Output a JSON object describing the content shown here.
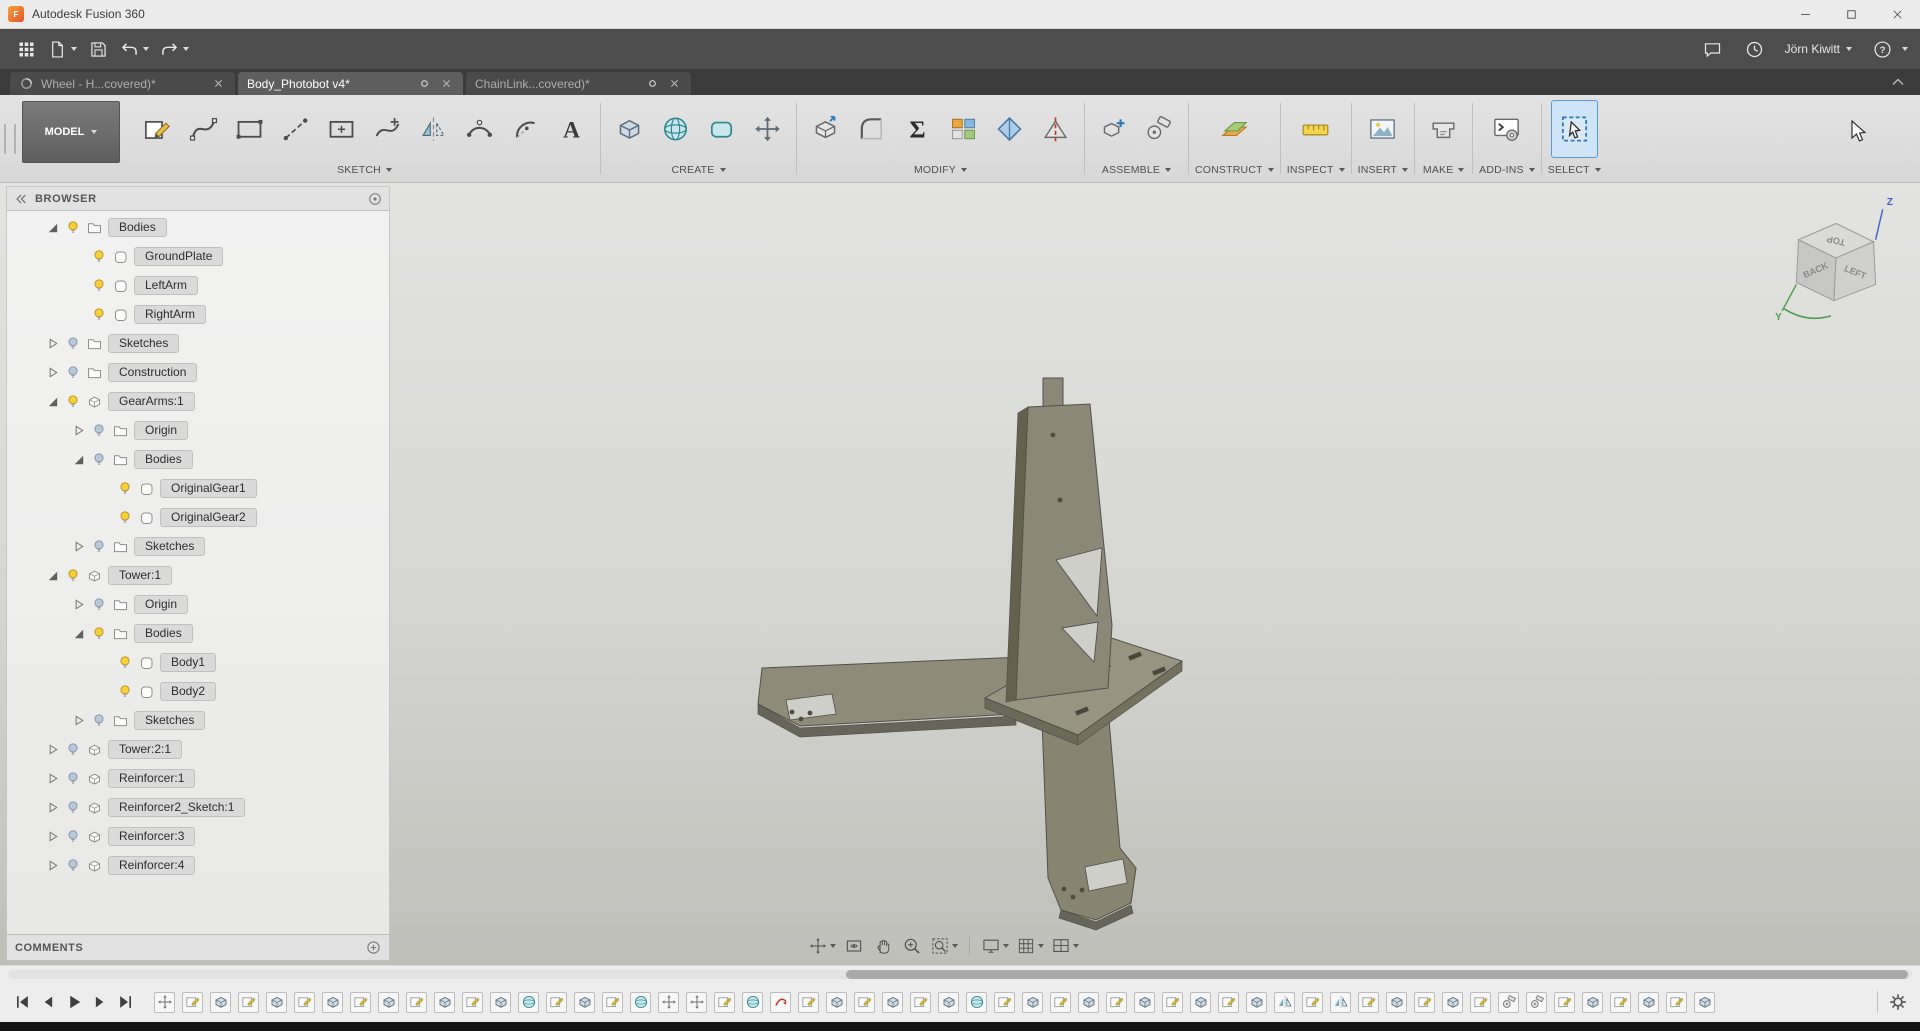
{
  "colors": {
    "accent_blue": "#2e78c2",
    "bulb_on": "#f6cf39",
    "bulb_off": "#b8c8d8",
    "model_olive": "#8b8877",
    "logo_orange": "#e2552b"
  },
  "title_bar": {
    "app_title": "Autodesk Fusion 360",
    "window_controls": [
      "minimize",
      "maximize",
      "close"
    ]
  },
  "quick_access": {
    "left_icons": [
      "apps-grid",
      "file-menu",
      "save",
      "undo",
      "redo"
    ],
    "right_icons": [
      "comment",
      "job-status"
    ],
    "user_name": "Jörn Kiwitt",
    "help_label": "?"
  },
  "document_tabs": {
    "overflow_icon": "chevron-up",
    "tabs": [
      {
        "label": "Wheel - H...covered)*",
        "active": false,
        "leading_icon": "fusion-doc",
        "status_dot": false
      },
      {
        "label": "Body_Photobot v4*",
        "active": true,
        "leading_icon": null,
        "status_dot": true
      },
      {
        "label": "ChainLink...covered)*",
        "active": false,
        "leading_icon": null,
        "status_dot": true
      }
    ]
  },
  "ribbon": {
    "workspace_label": "MODEL",
    "groups": [
      {
        "label": "SKETCH",
        "icons": [
          "create-sketch",
          "spline",
          "rectangle-2-point",
          "construction-line",
          "rectangle-center",
          "spline-point",
          "mirror-sketch",
          "arc-3-point",
          "arc-center",
          "sketch-text"
        ]
      },
      {
        "label": "CREATE",
        "icons": [
          "extrude",
          "sphere",
          "box",
          "form"
        ]
      },
      {
        "label": "MODIFY",
        "icons": [
          "press-pull",
          "fillet",
          "change-parameters",
          "appearance",
          "section-analysis",
          "split-body"
        ]
      },
      {
        "label": "ASSEMBLE",
        "icons": [
          "new-component",
          "joint"
        ]
      },
      {
        "label": "CONSTRUCT",
        "icons": [
          "construction-plane"
        ]
      },
      {
        "label": "INSPECT",
        "icons": [
          "measure"
        ]
      },
      {
        "label": "INSERT",
        "icons": [
          "insert-image"
        ]
      },
      {
        "label": "MAKE",
        "icons": [
          "3d-print"
        ]
      },
      {
        "label": "ADD-INS",
        "icons": [
          "scripts-addins"
        ]
      },
      {
        "label": "SELECT",
        "icons": [
          "select-tool"
        ]
      }
    ]
  },
  "browser": {
    "header_label": "BROWSER",
    "collapse_icon": "collapse-left",
    "menu_icon": "circle-dot",
    "comments_label": "COMMENTS",
    "comments_icon": "circle-plus",
    "tree": [
      {
        "label": "Bodies",
        "level": 0,
        "expand": "open",
        "bulb": "on",
        "icon": "folder"
      },
      {
        "label": "GroundPlate",
        "level": 1,
        "expand": "none",
        "bulb": "on",
        "icon": "body"
      },
      {
        "label": "LeftArm",
        "level": 1,
        "expand": "none",
        "bulb": "on",
        "icon": "body"
      },
      {
        "label": "RightArm",
        "level": 1,
        "expand": "none",
        "bulb": "on",
        "icon": "body"
      },
      {
        "label": "Sketches",
        "level": 0,
        "expand": "closed",
        "bulb": "off",
        "icon": "folder"
      },
      {
        "label": "Construction",
        "level": 0,
        "expand": "closed",
        "bulb": "off",
        "icon": "folder"
      },
      {
        "label": "GearArms:1",
        "level": 0,
        "expand": "open",
        "bulb": "on",
        "icon": "component"
      },
      {
        "label": "Origin",
        "level": 1,
        "expand": "closed",
        "bulb": "off",
        "icon": "folder"
      },
      {
        "label": "Bodies",
        "level": 1,
        "expand": "open",
        "bulb": "off",
        "icon": "folder"
      },
      {
        "label": "OriginalGear1",
        "level": 2,
        "expand": "none",
        "bulb": "on",
        "icon": "body"
      },
      {
        "label": "OriginalGear2",
        "level": 2,
        "expand": "none",
        "bulb": "on",
        "icon": "body"
      },
      {
        "label": "Sketches",
        "level": 1,
        "expand": "closed",
        "bulb": "off",
        "icon": "folder"
      },
      {
        "label": "Tower:1",
        "level": 0,
        "expand": "open",
        "bulb": "on",
        "icon": "component"
      },
      {
        "label": "Origin",
        "level": 1,
        "expand": "closed",
        "bulb": "off",
        "icon": "folder"
      },
      {
        "label": "Bodies",
        "level": 1,
        "expand": "open",
        "bulb": "on",
        "icon": "folder"
      },
      {
        "label": "Body1",
        "level": 2,
        "expand": "none",
        "bulb": "on",
        "icon": "body"
      },
      {
        "label": "Body2",
        "level": 2,
        "expand": "none",
        "bulb": "on",
        "icon": "body"
      },
      {
        "label": "Sketches",
        "level": 1,
        "expand": "closed",
        "bulb": "off",
        "icon": "folder"
      },
      {
        "label": "Tower:2:1",
        "level": 0,
        "expand": "closed",
        "bulb": "off",
        "icon": "component"
      },
      {
        "label": "Reinforcer:1",
        "level": 0,
        "expand": "closed",
        "bulb": "off",
        "icon": "component"
      },
      {
        "label": "Reinforcer2_Sketch:1",
        "level": 0,
        "expand": "closed",
        "bulb": "off",
        "icon": "component"
      },
      {
        "label": "Reinforcer:3",
        "level": 0,
        "expand": "closed",
        "bulb": "off",
        "icon": "component"
      },
      {
        "label": "Reinforcer:4",
        "level": 0,
        "expand": "closed",
        "bulb": "off",
        "icon": "component"
      }
    ]
  },
  "viewcube": {
    "top": "TOP",
    "left_face": "BACK",
    "right_face": "LEFT",
    "axis_z": "Z",
    "axis_y": "Y"
  },
  "nav_bar": {
    "icons": [
      {
        "name": "pan",
        "dropdown": true
      },
      {
        "name": "look-at",
        "dropdown": false
      },
      {
        "name": "pan-hand",
        "dropdown": false
      },
      {
        "name": "zoom",
        "dropdown": false
      },
      {
        "name": "fit",
        "dropdown": true
      },
      {
        "name": "display-settings",
        "dropdown": true
      },
      {
        "name": "grid-settings",
        "dropdown": true
      },
      {
        "name": "viewports",
        "dropdown": true
      }
    ]
  },
  "timeline": {
    "controls": [
      "go-to-start",
      "step-back",
      "play",
      "step-forward",
      "go-to-end"
    ],
    "settings_icon": "gear",
    "features": [
      "move",
      "sketch",
      "extrude",
      "sketch",
      "extrude",
      "sketch",
      "extrude",
      "sketch",
      "extrude",
      "sketch",
      "extrude",
      "sketch",
      "extrude",
      "form",
      "sketch",
      "extrude",
      "sketch",
      "form",
      "move",
      "move",
      "sketch",
      "form",
      "revolve",
      "sketch",
      "extrude",
      "sketch",
      "extrude",
      "sketch",
      "extrude",
      "form",
      "sketch",
      "extrude",
      "sketch",
      "extrude",
      "sketch",
      "extrude",
      "sketch",
      "extrude",
      "sketch",
      "extrude",
      "mirror",
      "sketch",
      "mirror",
      "sketch",
      "extrude",
      "sketch",
      "extrude",
      "sketch",
      "joint",
      "joint",
      "sketch",
      "extrude",
      "sketch",
      "extrude",
      "sketch",
      "extrude"
    ]
  }
}
